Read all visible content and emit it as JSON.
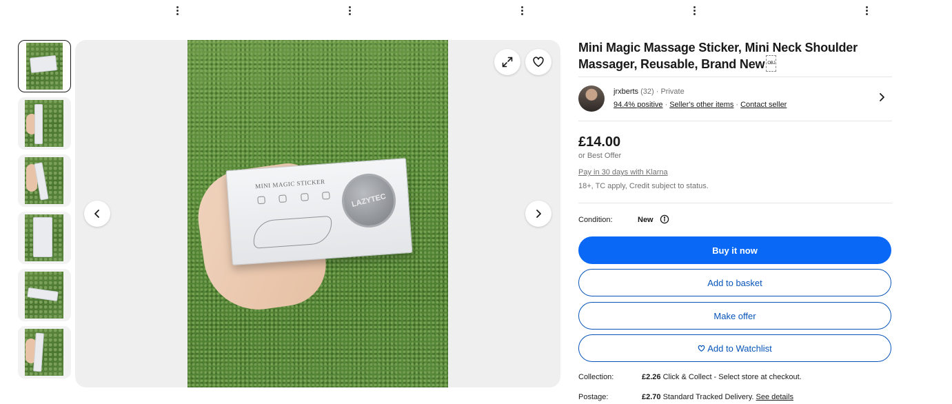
{
  "product": {
    "title": "Mini Magic Massage Sticker, Mini Neck Shoulder Massager, Reusable, Brand New",
    "obj_badge": "OBJ"
  },
  "gallery": {
    "box_title": "MINI MAGIC STICKER",
    "box_brand": "LAZYTEC"
  },
  "seller": {
    "name": "jrxberts",
    "count": "(32)",
    "type": "· Private",
    "feedback": "94.4% positive",
    "other_items": "Seller's other items",
    "contact": "Contact seller",
    "sep": "·"
  },
  "pricing": {
    "price": "£14.00",
    "best_offer": "or Best Offer",
    "klarna": "Pay in 30 days with Klarna",
    "klarna_terms": "18+, TC apply, Credit subject to status."
  },
  "condition": {
    "label": "Condition:",
    "value": "New"
  },
  "actions": {
    "buy_now": "Buy it now",
    "add_basket": "Add to basket",
    "make_offer": "Make offer",
    "watchlist": "Add to Watchlist"
  },
  "shipping": {
    "collection_label": "Collection:",
    "collection_price": "£2.26",
    "collection_text": "Click & Collect - Select store at checkout.",
    "postage_label": "Postage:",
    "postage_price": "£2.70",
    "postage_text": "Standard Tracked Delivery.",
    "see_details": "See details"
  },
  "colors": {
    "primary": "#0968f6",
    "link_blue": "#0654ba",
    "text": "#191919",
    "muted": "#707070"
  },
  "icons": [
    "more-vertical-icon",
    "expand-icon",
    "heart-icon",
    "chevron-left-icon",
    "chevron-right-icon",
    "info-icon"
  ]
}
